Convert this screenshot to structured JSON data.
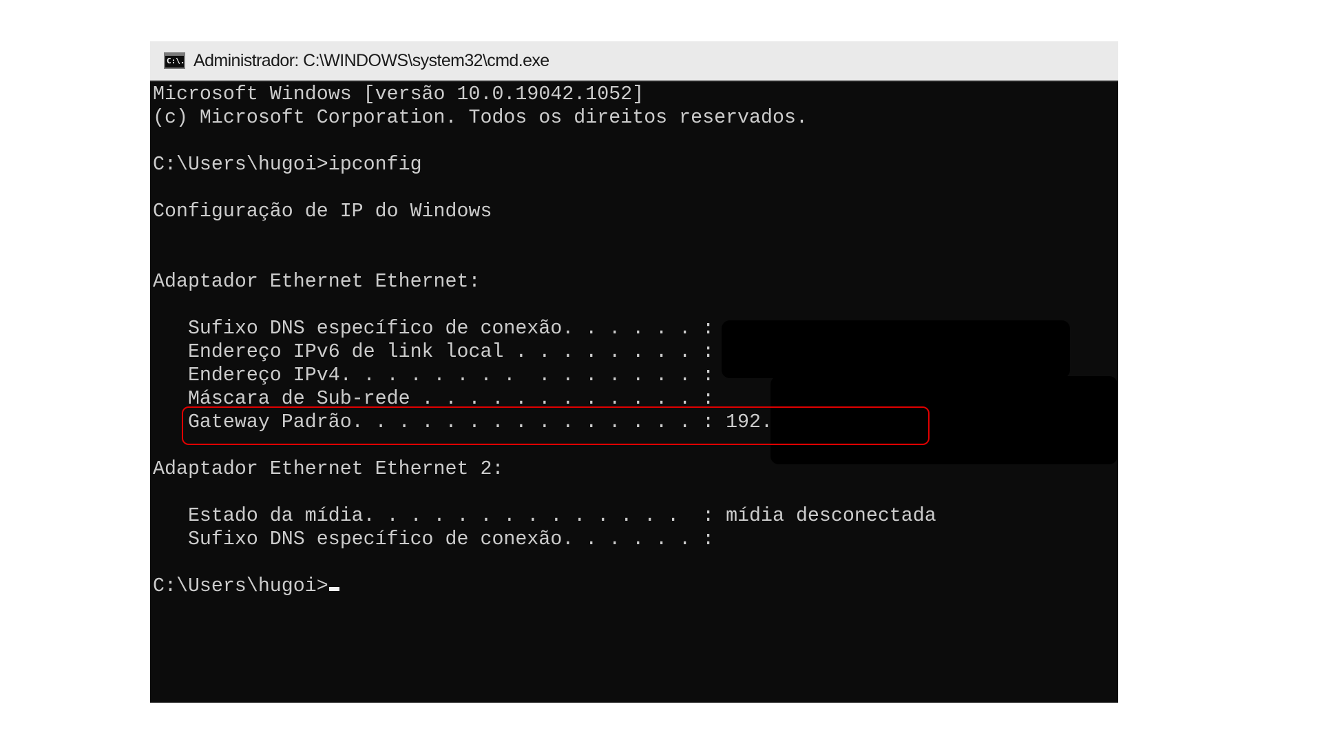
{
  "window": {
    "title": "Administrador: C:\\WINDOWS\\system32\\cmd.exe",
    "icon": "cmd-console-icon",
    "icon_glyph": "C:\\."
  },
  "console": {
    "lines": [
      "Microsoft Windows [versão 10.0.19042.1052]",
      "(c) Microsoft Corporation. Todos os direitos reservados.",
      "",
      "C:\\Users\\hugoi>ipconfig",
      "",
      "Configuração de IP do Windows",
      "",
      "",
      "Adaptador Ethernet Ethernet:",
      "",
      "   Sufixo DNS específico de conexão. . . . . . :",
      "   Endereço IPv6 de link local . . . . . . . . :",
      "   Endereço IPv4. . . . . . . .  . . . . . . . :",
      "   Máscara de Sub-rede . . . . . . . . . . . . :",
      "   Gateway Padrão. . . . . . . . . . . . . . . : 192.",
      "",
      "Adaptador Ethernet Ethernet 2:",
      "",
      "   Estado da mídia. . . . . . . . . . . . . .  : mídia desconectada",
      "   Sufixo DNS específico de conexão. . . . . . :",
      "",
      "C:\\Users\\hugoi>"
    ],
    "colors": {
      "background": "#0c0c0c",
      "foreground": "#cccccc",
      "highlight_border": "#e00000"
    },
    "highlighted_line": "Gateway Padrão",
    "redactions": [
      "adapter-values-redaction",
      "gateway-value-redaction"
    ]
  }
}
